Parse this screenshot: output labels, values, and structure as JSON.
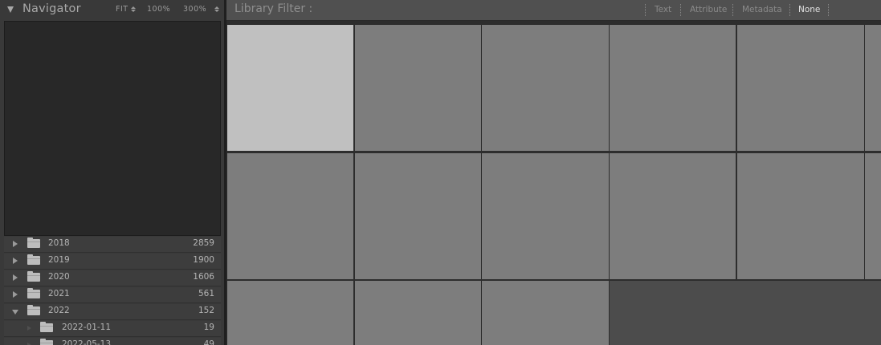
{
  "navigator": {
    "title": "Navigator",
    "zoom_options": [
      "FIT",
      "100%",
      "300%"
    ]
  },
  "folders": [
    {
      "name": "2018",
      "count": "2859",
      "expanded": false,
      "level": 0
    },
    {
      "name": "2019",
      "count": "1900",
      "expanded": false,
      "level": 0
    },
    {
      "name": "2020",
      "count": "1606",
      "expanded": false,
      "level": 0
    },
    {
      "name": "2021",
      "count": "561",
      "expanded": false,
      "level": 0
    },
    {
      "name": "2022",
      "count": "152",
      "expanded": true,
      "level": 0
    },
    {
      "name": "2022-01-11",
      "count": "19",
      "level": 1
    },
    {
      "name": "2022-05-13",
      "count": "49",
      "level": 1
    }
  ],
  "library_filter": {
    "title": "Library Filter :",
    "options": [
      "Text",
      "Attribute",
      "Metadata",
      "None"
    ],
    "active": "None"
  },
  "grid": {
    "selected_index": 0,
    "thumbnails_total": 15
  },
  "colors": {
    "cell": "#7d7d7d",
    "cell_selected": "#c0c0c0",
    "panel": "#393939",
    "filter_bar": "#505050"
  }
}
